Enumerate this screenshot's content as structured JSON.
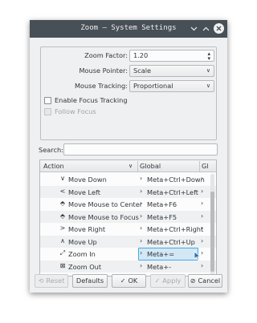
{
  "window": {
    "title": "Zoom — System Settings"
  },
  "form": {
    "zoom_factor_label": "Zoom Factor:",
    "zoom_factor_value": "1.20",
    "mouse_pointer_label": "Mouse Pointer:",
    "mouse_pointer_value": "Scale",
    "mouse_tracking_label": "Mouse Tracking:",
    "mouse_tracking_value": "Proportional",
    "enable_focus_tracking_label": "Enable Focus Tracking",
    "follow_focus_label": "Follow Focus"
  },
  "search": {
    "label": "Search:",
    "value": ""
  },
  "table": {
    "headers": {
      "action": "Action",
      "global": "Global",
      "global_alt": "Gl"
    },
    "rows": [
      {
        "icon": "chevron-down",
        "glyph": "∨",
        "action": "Move Down",
        "global": "Meta+Ctrl+Down"
      },
      {
        "icon": "chevron-left",
        "glyph": "<",
        "action": "Move Left",
        "global": "Meta+Ctrl+Left"
      },
      {
        "icon": "center",
        "glyph": "⬘",
        "action": "Move Mouse to Center",
        "global": "Meta+F6"
      },
      {
        "icon": "focus",
        "glyph": "⬘",
        "action": "Move Mouse to Focus",
        "global": "Meta+F5"
      },
      {
        "icon": "chevron-right",
        "glyph": ">",
        "action": "Move Right",
        "global": "Meta+Ctrl+Right"
      },
      {
        "icon": "chevron-up",
        "glyph": "∧",
        "action": "Move Up",
        "global": "Meta+Ctrl+Up"
      },
      {
        "icon": "zoom-in",
        "glyph": "⤢",
        "action": "Zoom In",
        "global": "Meta+="
      },
      {
        "icon": "zoom-out",
        "glyph": "⊠",
        "action": "Zoom Out",
        "global": "Meta+-"
      }
    ]
  },
  "buttons": {
    "reset": "Reset",
    "defaults": "Defaults",
    "ok": "OK",
    "apply": "Apply",
    "cancel": "Cancel"
  },
  "colors": {
    "titlebar": "#475057",
    "accent": "#3daee9",
    "window": "#eff0f1"
  }
}
